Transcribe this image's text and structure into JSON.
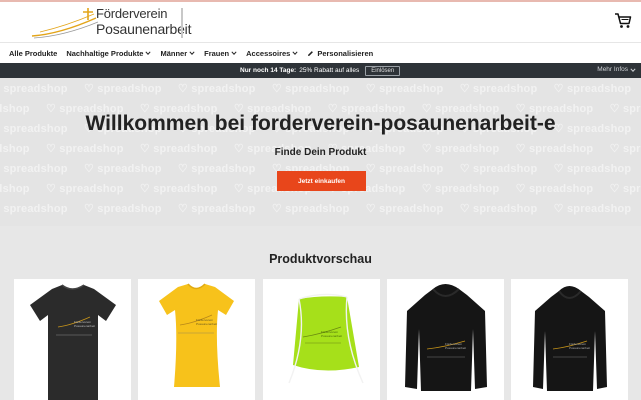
{
  "header": {
    "logo_line1": "Förderverein",
    "logo_line2": "Posaunenarbeit",
    "cart_icon": "shopping-cart-icon"
  },
  "nav": {
    "items": [
      {
        "label": "Alle Produkte",
        "dropdown": false
      },
      {
        "label": "Nachhaltige Produkte",
        "dropdown": true
      },
      {
        "label": "Männer",
        "dropdown": true
      },
      {
        "label": "Frauen",
        "dropdown": true
      },
      {
        "label": "Accessoires",
        "dropdown": true
      },
      {
        "label": "Personalisieren",
        "dropdown": false,
        "icon": "pencil-icon"
      }
    ]
  },
  "promo": {
    "lead": "Nur noch 14 Tage:",
    "text": "25% Rabatt auf alles",
    "redeem": "Einlösen",
    "more": "Mehr Infos"
  },
  "hero": {
    "pattern_word": "spreadshop",
    "title": "Willkommen bei forderverein-posaunenarbeit-e",
    "subtitle": "Finde Dein Produkt",
    "cta": "Jetzt einkaufen"
  },
  "preview": {
    "title": "Produktvorschau",
    "products": [
      {
        "kind": "tshirt",
        "color": "#2b2b2b"
      },
      {
        "kind": "tshirt-women",
        "color": "#f7c21b"
      },
      {
        "kind": "gymbag",
        "color": "#a6e01a"
      },
      {
        "kind": "hoodie",
        "color": "#151515"
      },
      {
        "kind": "hoodie",
        "color": "#151515"
      }
    ]
  },
  "colors": {
    "accent": "#e8461b",
    "promo_bg": "#2e3338",
    "hero_bg": "#e4e4e4",
    "logo_gold": "#e3a51a"
  }
}
